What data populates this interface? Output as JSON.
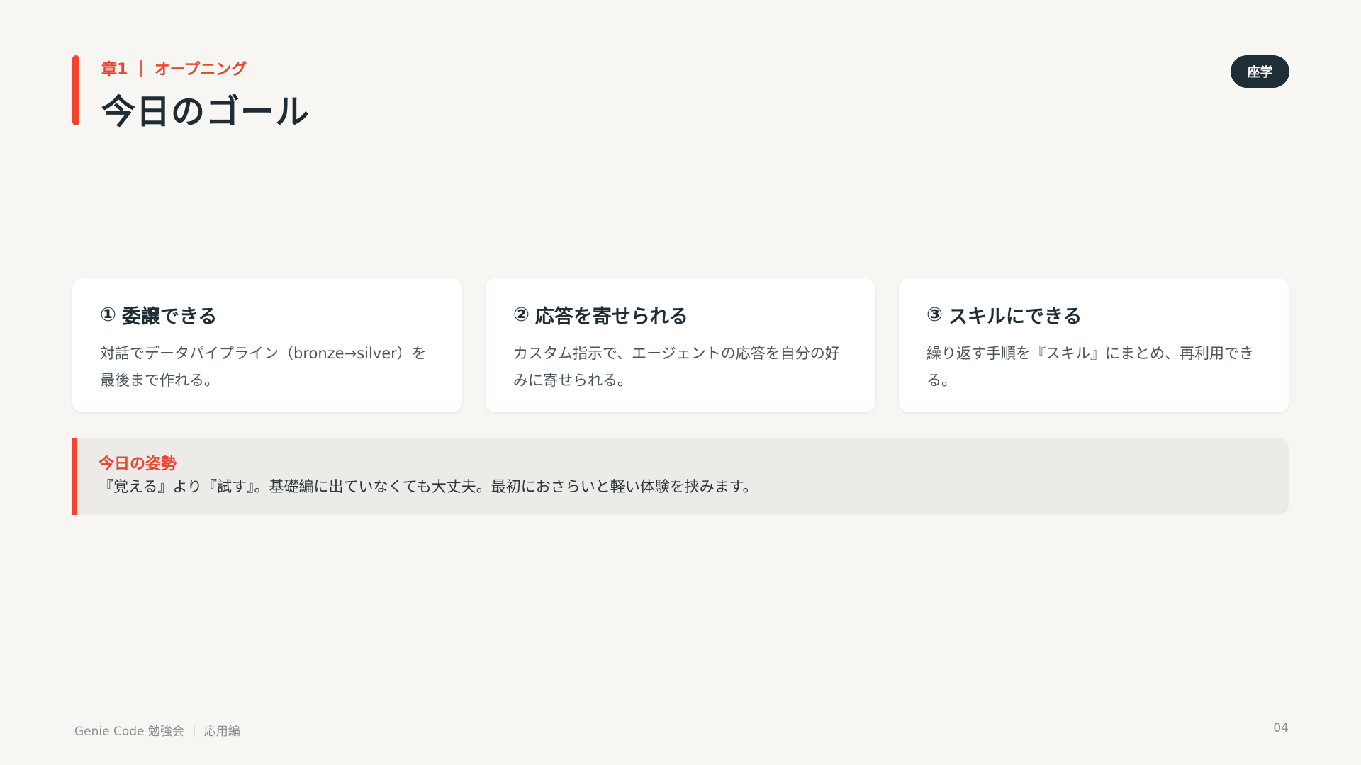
{
  "header": {
    "chapter": "章1 ｜ オープニング",
    "title": "今日のゴール",
    "badge": "座学"
  },
  "goals": [
    {
      "number": "①",
      "title": "委譲できる",
      "description": "対話でデータパイプライン（bronze→silver）を最後まで作れる。"
    },
    {
      "number": "②",
      "title": "応答を寄せられる",
      "description": "カスタム指示で、エージェントの応答を自分の好みに寄せられる。"
    },
    {
      "number": "③",
      "title": "スキルにできる",
      "description": "繰り返す手順を『スキル』にまとめ、再利用できる。"
    }
  ],
  "attitude": {
    "title": "今日の姿勢",
    "text": "『覚える』より『試す』。基礎編に出ていなくても大丈夫。最初におさらいと軽い体験を挟みます。"
  },
  "footer": {
    "left": "Genie Code 勉強会 ｜ 応用編",
    "page": "04"
  },
  "colors": {
    "accent": "#f0442f",
    "dark": "#1e2d36",
    "background": "#f7f6f3"
  }
}
